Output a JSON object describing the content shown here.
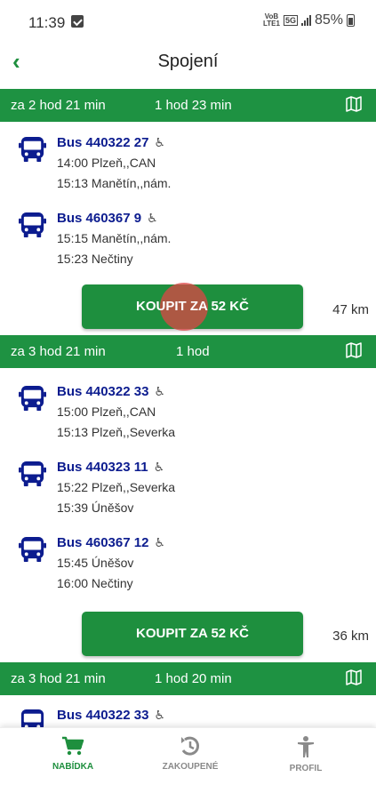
{
  "status_bar": {
    "time": "11:39",
    "net_top": "VoB",
    "net_bottom": "LTE1",
    "net_badge": "5G",
    "battery": "85%"
  },
  "header": {
    "title": "Spojení"
  },
  "connections": [
    {
      "wait": "za 2 hod 21 min",
      "duration": "1 hod 23 min",
      "legs": [
        {
          "bus": "Bus 440322 27",
          "stop1": "14:00 Plzeň,,CAN",
          "stop2": "15:13 Manětín,,nám."
        },
        {
          "bus": "Bus 460367 9",
          "stop1": "15:15 Manětín,,nám.",
          "stop2": "15:23 Nečtiny"
        }
      ],
      "buy": "KOUPIT ZA 52 KČ",
      "distance": "47 km"
    },
    {
      "wait": "za 3 hod 21 min",
      "duration": "1 hod",
      "legs": [
        {
          "bus": "Bus 440322 33",
          "stop1": "15:00 Plzeň,,CAN",
          "stop2": "15:13 Plzeň,,Severka"
        },
        {
          "bus": "Bus 440323 11",
          "stop1": "15:22 Plzeň,,Severka",
          "stop2": "15:39 Úněšov"
        },
        {
          "bus": "Bus 460367 12",
          "stop1": "15:45 Úněšov",
          "stop2": "16:00 Nečtiny"
        }
      ],
      "buy": "KOUPIT ZA 52 KČ",
      "distance": "36 km"
    },
    {
      "wait": "za 3 hod 21 min",
      "duration": "1 hod 20 min",
      "legs": [
        {
          "bus": "Bus 440322 33"
        }
      ]
    }
  ],
  "nav": [
    {
      "label": "NABÍDKA",
      "icon": "cart-icon",
      "active": true
    },
    {
      "label": "ZAKOUPENÉ",
      "icon": "history-icon",
      "active": false
    },
    {
      "label": "PROFIL",
      "icon": "person-icon",
      "active": false
    }
  ],
  "colors": {
    "primary_green": "#1e9242",
    "bus_blue": "#0c1c8f",
    "ripple": "#de4646"
  }
}
